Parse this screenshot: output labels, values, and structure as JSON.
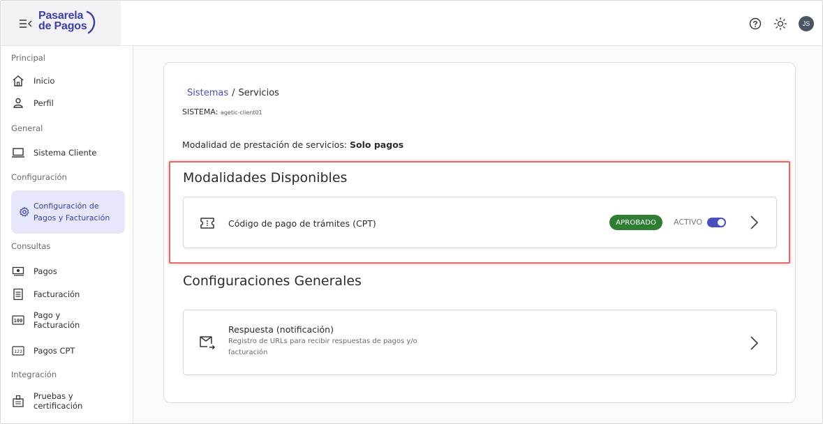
{
  "brand": {
    "line1": "Pasarela",
    "line2": "de Pagos",
    "color": "#3a3fae"
  },
  "topbar": {
    "avatar_initials": "JS",
    "icons": [
      "help-icon",
      "theme-sun-icon"
    ]
  },
  "sidebar": {
    "sections": {
      "principal": "Principal",
      "general": "General",
      "configuracion": "Configuración",
      "consultas": "Consultas",
      "integracion": "Integración"
    },
    "items": {
      "inicio": "Inicio",
      "perfil": "Perfil",
      "sistema_cliente": "Sistema Cliente",
      "config_pagos": "Configuración de Pagos y Facturación",
      "pagos": "Pagos",
      "facturacion": "Facturación",
      "pago_facturacion": "Pago y Facturación",
      "pagos_cpt": "Pagos CPT",
      "pruebas": "Pruebas y certificación"
    },
    "active_bg": "#e7e7fb"
  },
  "main": {
    "breadcrumb": {
      "link": "Sistemas",
      "separator": "/",
      "current": "Servicios"
    },
    "sistema": {
      "label": "SISTEMA:",
      "value": "agetic-client01"
    },
    "modalidad": {
      "label": "Modalidad de prestación de servicios:",
      "value": "Solo pagos"
    },
    "modalidades": {
      "title": "Modalidades Disponibles",
      "item": {
        "label": "Código de pago de trámites (CPT)",
        "badge": "APROBADO",
        "status": "ACTIVO",
        "toggle_on": true
      }
    },
    "configuraciones": {
      "title": "Configuraciones Generales",
      "item": {
        "label": "Respuesta (notificación)",
        "description": "Registro de URLs para recibir respuestas de pagos y/o facturación"
      }
    }
  },
  "colors": {
    "accent": "#4a4fc0",
    "badge_green": "#2e7d32",
    "highlight_red": "#e06a6a"
  }
}
